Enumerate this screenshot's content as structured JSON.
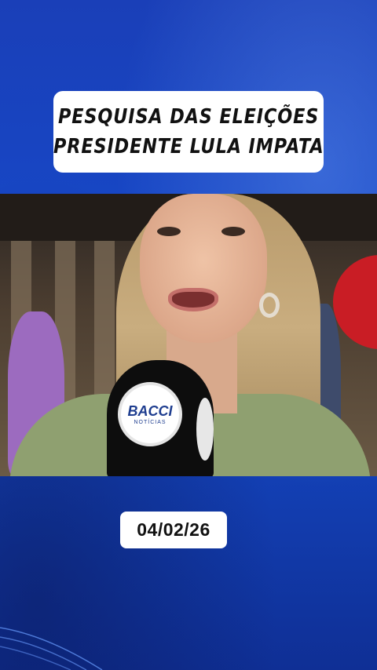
{
  "headline": {
    "line1": "PESQUISA DAS ELEIÇÕES",
    "line2": "PRESIDENTE LULA IMPATA"
  },
  "video": {
    "mic_logo_main": "BACCI",
    "mic_logo_sub": "NOTÍCIAS"
  },
  "date": "04/02/26",
  "colors": {
    "background": "#1746c4",
    "box": "#ffffff",
    "text": "#111111"
  }
}
